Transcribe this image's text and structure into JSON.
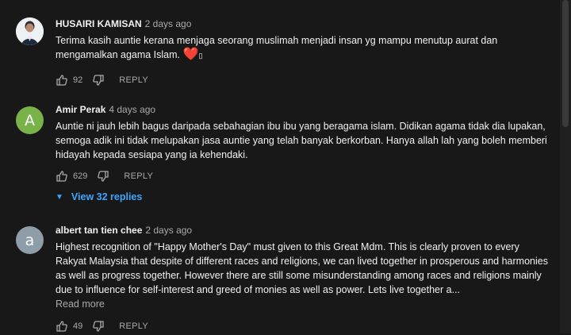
{
  "comments": [
    {
      "author": "HUSAIRI KAMISAN",
      "time": "2 days ago",
      "text": "Terima kasih auntie kerana menjaga seorang muslimah menjadi insan yg mampu menutup aurat dan mengamalkan agama Islam.",
      "heart": "❤️",
      "trailing": "▯",
      "likes": "92",
      "reply_label": "REPLY"
    },
    {
      "author": "Amir Perak",
      "time": "4 days ago",
      "avatar_letter": "A",
      "text": "Auntie ni jauh lebih bagus daripada sebahagian ibu ibu yang beragama islam. Didikan agama tidak dia lupakan, semoga adik ini tidak melupakan jasa auntie yang telah banyak berkorban. Hanya allah lah yang boleh memberi hidayah kepada sesiapa yang ia kehendaki.",
      "likes": "629",
      "reply_label": "REPLY",
      "view_replies": "View 32 replies"
    },
    {
      "author": "albert tan tien chee",
      "time": "2 days ago",
      "avatar_letter": "a",
      "text": "Highest recognition of \"Happy Mother's Day\" must given to this Great Mdm. This is clearly proven to every Rakyat Malaysia that despite of different races and religions, we can lived together in prosperous and harmonies as well as progress together. However there are still some misunderstanding among races and religions mainly due to influence for self-interest and greed of monies as well as power. Lets live together a...",
      "read_more": "Read more",
      "likes": "49",
      "reply_label": "REPLY"
    }
  ],
  "colors": {
    "background": "#181818",
    "link_blue": "#3ea6ff",
    "avatar_green": "#7ab24a",
    "avatar_grey": "#8e9ea8"
  }
}
